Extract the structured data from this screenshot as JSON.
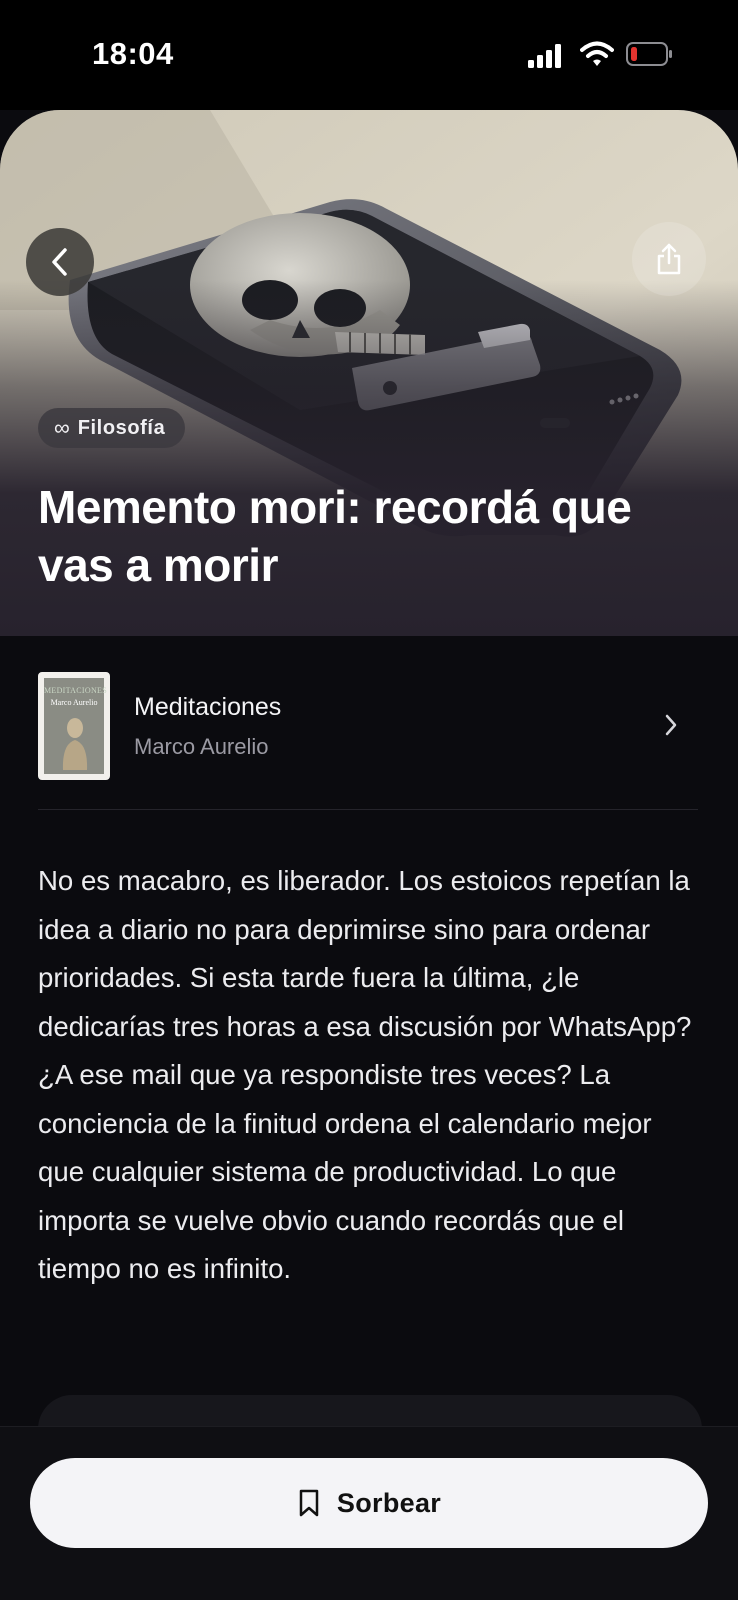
{
  "status_bar": {
    "time": "18:04",
    "icons": [
      "signal-icon",
      "wifi-icon",
      "battery-low-icon"
    ],
    "battery_color": "#e3342f"
  },
  "hero": {
    "category": {
      "icon": "infinity-icon",
      "label": "Filosofía"
    },
    "title": "Memento mori: recordá que vas a morir",
    "back_icon": "chevron-left-icon",
    "share_icon": "share-icon"
  },
  "book": {
    "cover_title": "MEDITACIONES",
    "cover_author": "Marco Aurelio",
    "title": "Meditaciones",
    "author": "Marco Aurelio",
    "chevron_icon": "chevron-right-icon"
  },
  "body": {
    "text": "No es macabro, es liberador. Los estoicos repetían la idea a diario no para deprimirse sino para ordenar prioridades. Si esta tarde fuera la última, ¿le dedicarías tres horas a esa discusión por WhatsApp? ¿A ese mail que ya respondiste tres veces? La conciencia de la finitud ordena el calendario mejor que cualquier sistema de productividad. Lo que importa se vuelve obvio cuando recordás que el tiempo no es infinito."
  },
  "action": {
    "icon": "bookmark-icon",
    "label": "Sorbear"
  },
  "colors": {
    "background": "#0b0b0f",
    "button_bg": "#f4f4f7",
    "hero_bottom": "#27222d"
  }
}
